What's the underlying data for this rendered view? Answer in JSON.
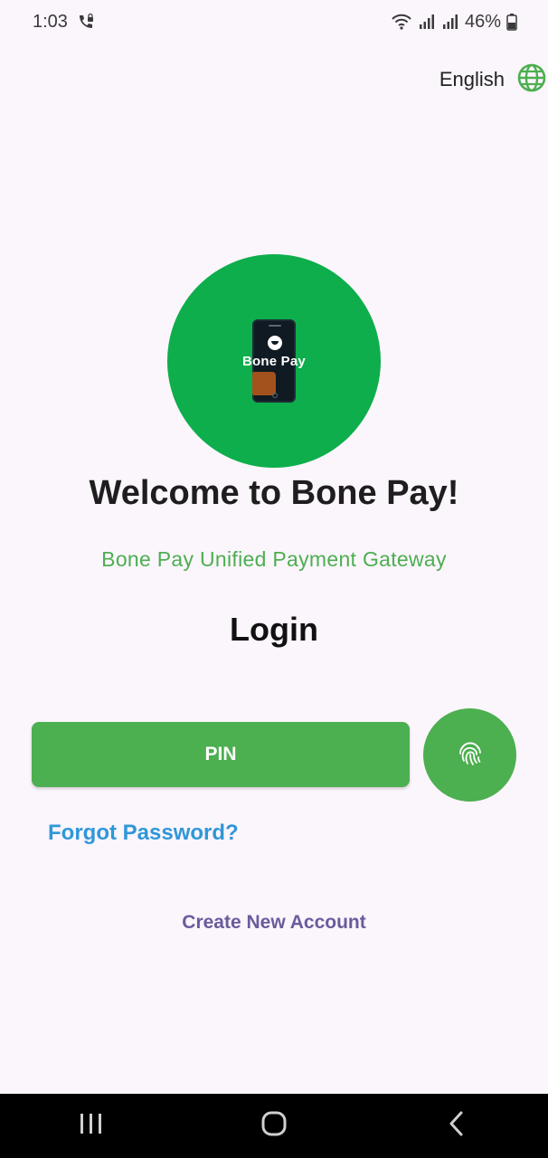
{
  "status_bar": {
    "time": "1:03",
    "battery": "46%",
    "icons": [
      "call-lock-icon",
      "wifi-icon",
      "signal-icon",
      "signal-icon",
      "battery-icon"
    ]
  },
  "language": {
    "label": "English",
    "icon": "globe-icon"
  },
  "logo": {
    "text": "Bone Pay"
  },
  "welcome": {
    "title": "Welcome to Bone Pay!",
    "subtitle": "Bone Pay Unified Payment Gateway"
  },
  "login": {
    "title": "Login",
    "pin_button": "PIN",
    "fingerprint_icon": "fingerprint-icon",
    "forgot_password": "Forgot Password?",
    "create_account": "Create New Account"
  },
  "colors": {
    "background": "#fbf5fc",
    "brand_green": "#4caf50",
    "logo_green": "#0dae4b",
    "link_blue": "#2f97d8",
    "link_purple": "#6a5b9c"
  },
  "nav_bar": {
    "buttons": [
      "recents-icon",
      "home-icon",
      "back-icon"
    ]
  }
}
